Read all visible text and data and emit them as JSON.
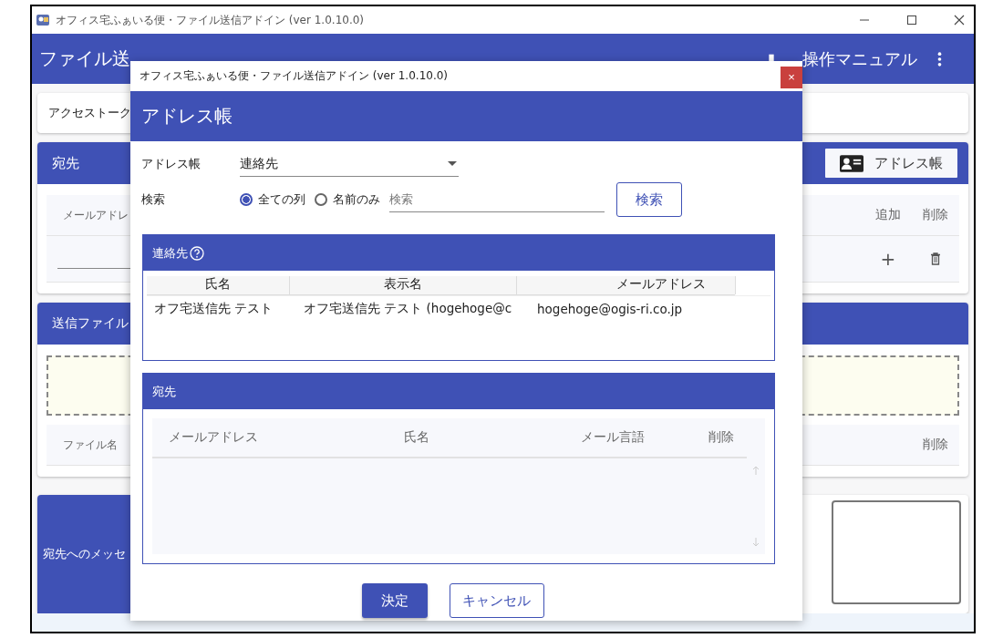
{
  "app": {
    "title": "オフィス宅ふぁいる便・ファイル送信アドイン (ver 1.0.10.0)",
    "header_title": "ファイル送",
    "manual_link": "操作マニュアル",
    "access_token_label": "アクセストーク",
    "recipients_card": {
      "title": "宛先",
      "address_book_button": "アドレス帳",
      "left_column": "メールアドレ",
      "right_columns": [
        "追加",
        "削除"
      ],
      "add_symbol": "+"
    },
    "files_card": {
      "title": "送信ファイル",
      "left_column": "ファイル名",
      "right_column": "削除"
    },
    "message_card": {
      "title": "宛先へのメッセ"
    }
  },
  "dialog": {
    "title": "オフィス宅ふぁいる便・ファイル送信アドイン (ver 1.0.10.0)",
    "close": "×",
    "heading": "アドレス帳",
    "address_book": {
      "label": "アドレス帳",
      "value": "連絡先"
    },
    "search": {
      "label": "検索",
      "options": [
        {
          "label": "全ての列",
          "selected": true
        },
        {
          "label": "名前のみ",
          "selected": false
        }
      ],
      "placeholder": "検索",
      "button": "検索"
    },
    "contacts": {
      "title": "連絡先",
      "columns": [
        "氏名",
        "表示名",
        "メールアドレス"
      ],
      "rows": [
        [
          "オフ宅送信先 テスト",
          "オフ宅送信先 テスト (hogehoge@c",
          "hogehoge@ogis-ri.co.jp"
        ]
      ]
    },
    "recipients": {
      "title": "宛先",
      "columns": [
        "メールアドレス",
        "氏名",
        "メール言語",
        "削除"
      ]
    },
    "buttons": [
      {
        "label": "決定",
        "kind": "primary"
      },
      {
        "label": "キャンセル",
        "kind": "secondary"
      }
    ]
  }
}
